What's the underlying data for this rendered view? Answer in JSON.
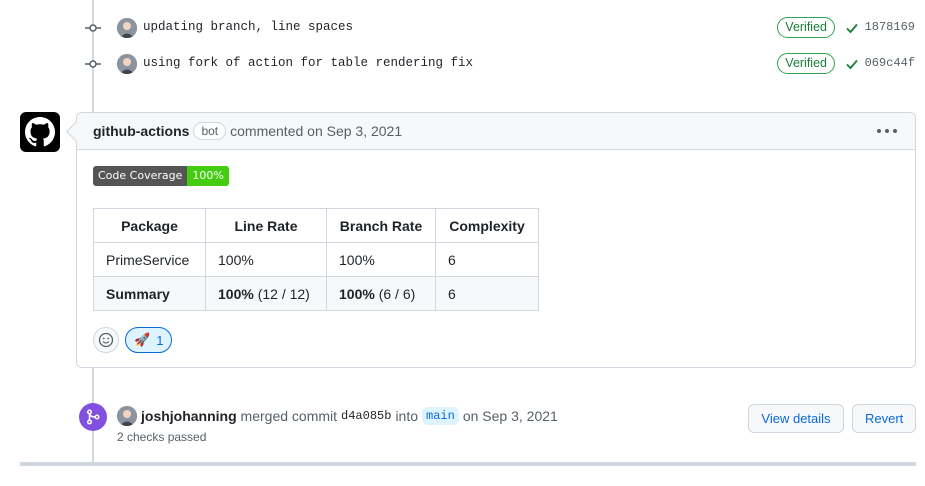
{
  "commits": [
    {
      "message": "updating branch, line spaces",
      "verified": "Verified",
      "sha": "1878169"
    },
    {
      "message": "using fork of action for table rendering fix",
      "verified": "Verified",
      "sha": "069c44f"
    }
  ],
  "comment": {
    "author": "github-actions",
    "bot_label": "bot",
    "commented_text": "commented on Sep 3, 2021",
    "badge": {
      "label": "Code Coverage",
      "value": "100%"
    },
    "table": {
      "headers": [
        "Package",
        "Line Rate",
        "Branch Rate",
        "Complexity"
      ],
      "rows": [
        {
          "package": "PrimeService",
          "line_rate": "100%",
          "branch_rate": "100%",
          "complexity": "6"
        }
      ],
      "summary": {
        "label": "Summary",
        "line_rate_bold": "100%",
        "line_rate_detail": "(12 / 12)",
        "branch_rate_bold": "100%",
        "branch_rate_detail": "(6 / 6)",
        "complexity": "6"
      }
    },
    "reactions": {
      "rocket_emoji": "🚀",
      "rocket_count": "1"
    }
  },
  "merge": {
    "author": "joshjohanning",
    "merged_text": "merged commit",
    "sha": "d4a085b",
    "into_text": "into",
    "branch": "main",
    "date_text": "on Sep 3, 2021",
    "checks": "2 checks passed",
    "view_details": "View details",
    "revert": "Revert"
  },
  "colors": {
    "accent": "#0969da",
    "merged": "#8250df",
    "success": "#1a7f37"
  }
}
